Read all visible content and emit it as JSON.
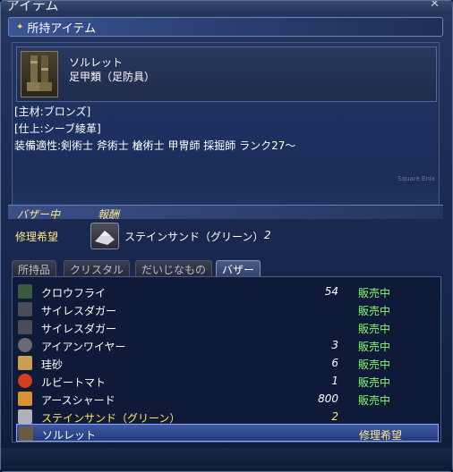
{
  "window": {
    "title": "アイテム",
    "close_icon": "close-icon"
  },
  "section": {
    "title": "所持アイテム",
    "star_icon": "star-icon"
  },
  "detail": {
    "item_name": "ソルレット",
    "item_type": "足甲類（足防具）",
    "attrs": [
      "[主材:ブロンズ]",
      "[仕上:シーブ綾革]",
      "装備適性:剣術士  斧術士  槍術士  甲冑師  採掘師      ランク27～"
    ],
    "watermark": "Square Enix"
  },
  "bazaar": {
    "header_status": "バザー中",
    "header_reward": "報酬",
    "status": "修理希望",
    "reward_name": "ステインサンド（グリーン）",
    "reward_qty": "2"
  },
  "tabs": [
    {
      "label": "所持品",
      "active": false
    },
    {
      "label": "クリスタル",
      "active": false
    },
    {
      "label": "だいじなもの",
      "active": false
    },
    {
      "label": "バザー",
      "active": true
    }
  ],
  "list": [
    {
      "name": "クロウフライ",
      "qty": "54",
      "status": "販売中",
      "icon": "bug-icon",
      "color": "#3a5a3a"
    },
    {
      "name": "サイレスダガー",
      "qty": "",
      "status": "販売中",
      "icon": "dagger-icon",
      "color": "#4a4a5a"
    },
    {
      "name": "サイレスダガー",
      "qty": "",
      "status": "販売中",
      "icon": "dagger-icon",
      "color": "#4a4a5a"
    },
    {
      "name": "アイアンワイヤー",
      "qty": "3",
      "status": "販売中",
      "icon": "wire-icon",
      "color": "#6a6a72"
    },
    {
      "name": "珪砂",
      "qty": "6",
      "status": "販売中",
      "icon": "sand-icon",
      "color": "#c8a050"
    },
    {
      "name": "ルビートマト",
      "qty": "1",
      "status": "販売中",
      "icon": "tomato-icon",
      "color": "#d04020"
    },
    {
      "name": "アースシャード",
      "qty": "800",
      "status": "販売中",
      "icon": "shard-icon",
      "color": "#d89030"
    },
    {
      "name": "ステインサンド（グリーン）",
      "qty": "2",
      "status": "",
      "icon": "sand-pile-icon",
      "color": "#b0b0b8"
    },
    {
      "name": "ソルレット",
      "qty": "",
      "status": "修理希望",
      "icon": "boots-icon",
      "color": "#6a5a40"
    }
  ]
}
